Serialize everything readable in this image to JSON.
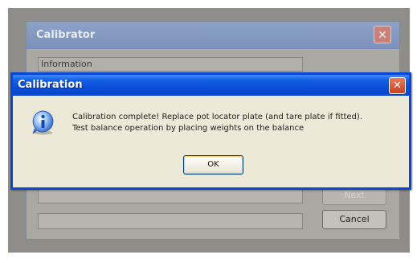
{
  "calibrator": {
    "title": "Calibrator",
    "close_symbol": "✕",
    "info_label": "Information",
    "cancel_label": "Cancel",
    "faded_button_label": "Next"
  },
  "dialog": {
    "title": "Calibration",
    "close_symbol": "✕",
    "icon": "info-icon",
    "message_line1": "Calibration complete! Replace pot locator plate (and tare plate if fitted).",
    "message_line2": "Test balance operation by placing weights on the balance",
    "ok_label": "OK"
  },
  "colors": {
    "titlebar_blue": "#0a4ed8",
    "close_red": "#c9401f",
    "dialog_face": "#ece9d8"
  }
}
